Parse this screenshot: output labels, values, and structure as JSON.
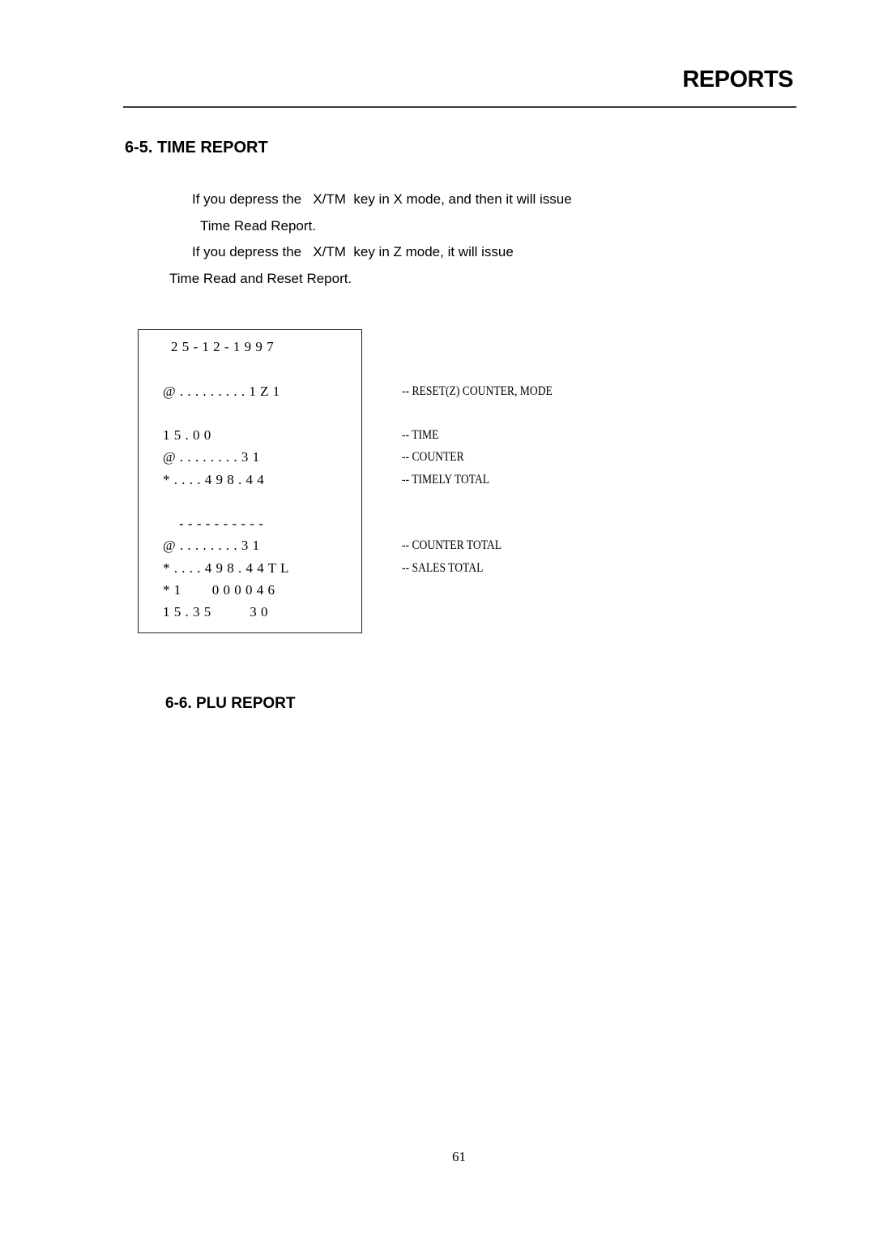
{
  "header": {
    "title": "REPORTS"
  },
  "section_time_report": {
    "title": "6-5. TIME REPORT",
    "paragraph_lines": [
      "If you depress the   X/TM  key in X mode, and then it will issue",
      "Time Read Report.",
      "If you depress the   X/TM  key in Z mode, it will issue",
      "Time Read and Reset Report."
    ],
    "receipt": {
      "lines": [
        "2 5 - 1 2 - 1 9 9 7",
        "@ . . . . . . . . . 1 Z 1",
        "1 5 . 0 0",
        "@ . . . . . . . . 3 1",
        "* . . . . 4 9 8 . 4 4",
        "- - - - - - - - - -",
        "@ . . . . . . . . 3 1",
        "* . . . . 4 9 8 . 4 4 T L",
        "* 1        0 0 0 0 4 6",
        "1 5 . 3 5          3 0"
      ]
    },
    "annotations": [
      "-- RESET(Z) COUNTER, MODE",
      "-- TIME",
      "-- COUNTER",
      "-- TIMELY TOTAL",
      "-- COUNTER TOTAL",
      "-- SALES TOTAL"
    ]
  },
  "section_plu_report": {
    "title": "6-6. PLU REPORT"
  },
  "footer": {
    "page_number": "61"
  }
}
